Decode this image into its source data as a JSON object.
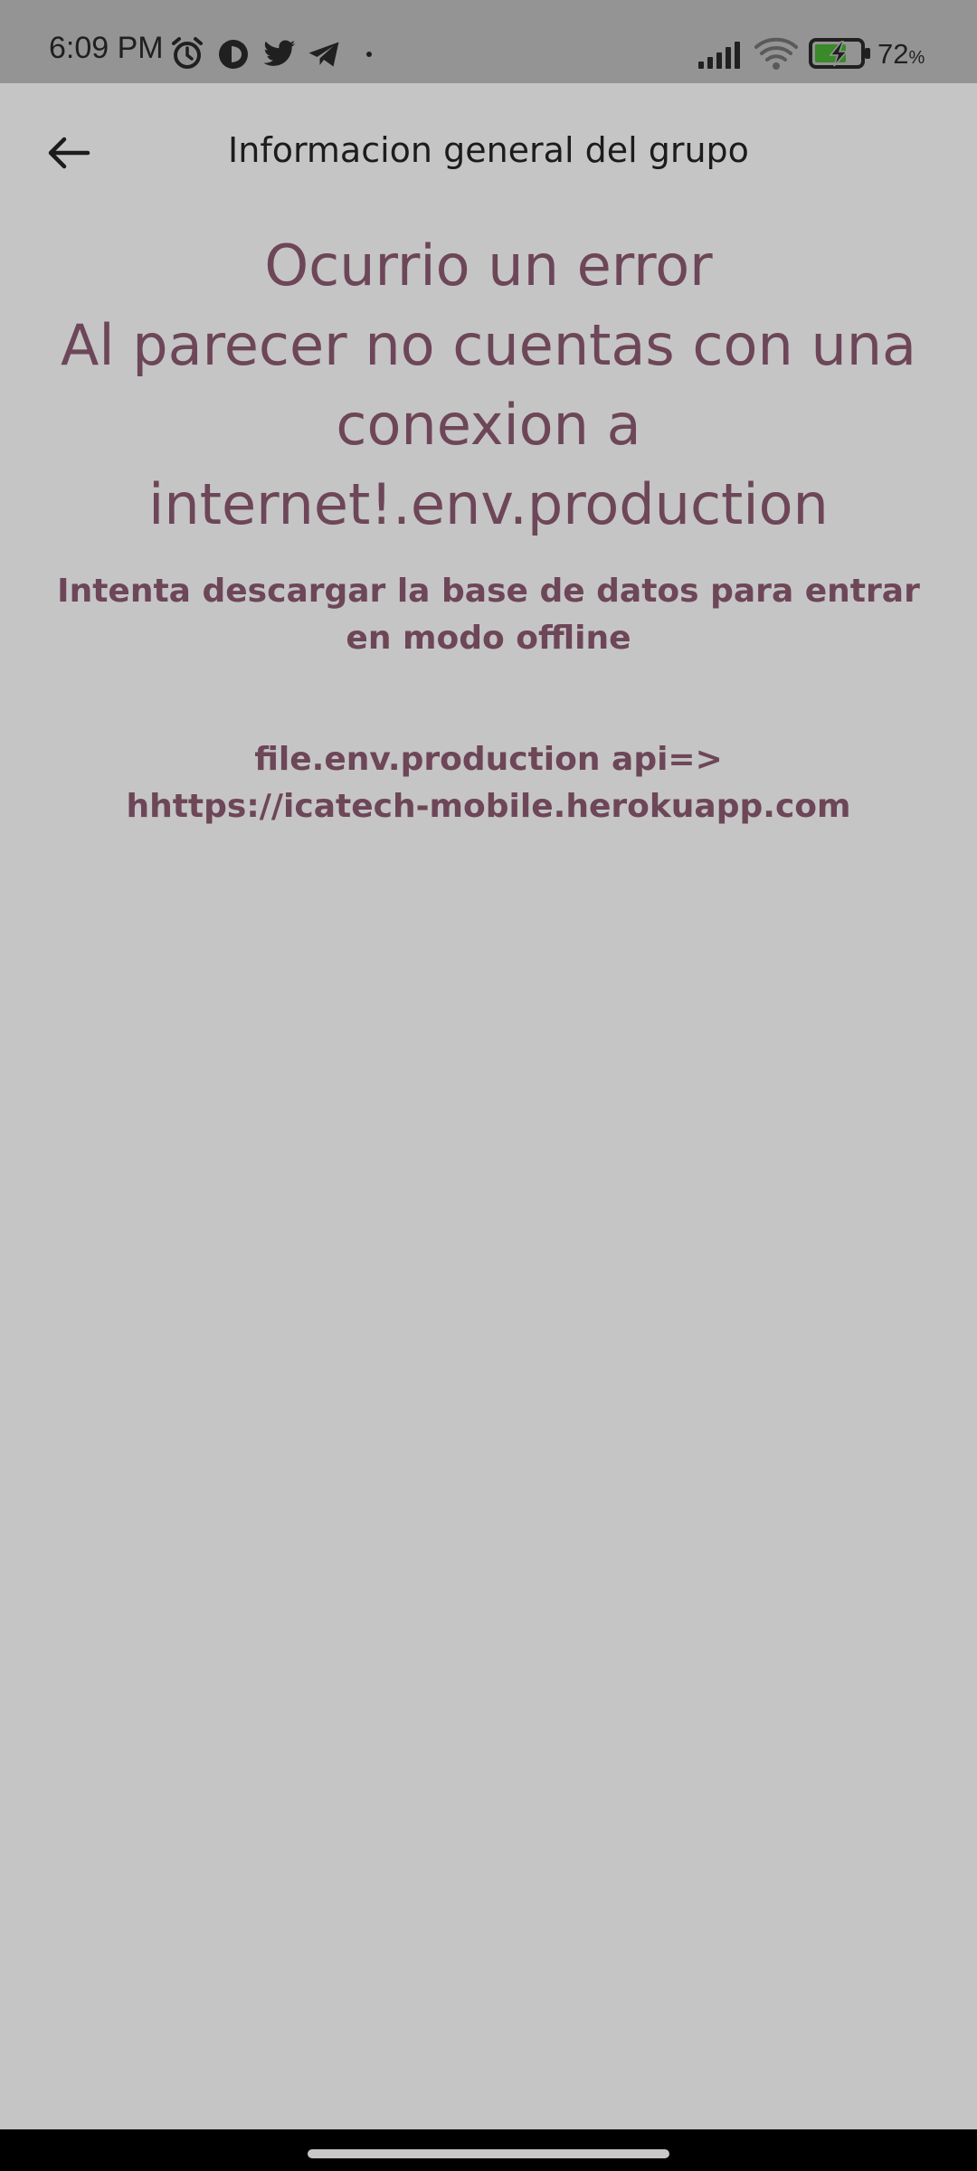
{
  "status_bar": {
    "time": "6:09 PM",
    "battery_percent": "72",
    "battery_unit": "%",
    "icons": [
      "alarm-icon",
      "app-notification-icon",
      "twitter-icon",
      "telegram-icon",
      "dot-icon",
      "signal-icon",
      "wifi-icon",
      "battery-charging-icon"
    ]
  },
  "app_bar": {
    "title": "Informacion general del grupo",
    "back_icon": "arrow-left-icon"
  },
  "error": {
    "title": "Ocurrio un error\n Al parecer no cuentas con una conexion a internet!.env.production",
    "subtitle": "Intenta descargar la base de datos para entrar en modo offline",
    "env_info": "file.env.production   api=>\nhhttps://icatech-mobile.herokuapp.com"
  },
  "colors": {
    "background": "#c5c5c5",
    "status_bar": "#949494",
    "error_text": "#6d4658",
    "title_text": "#1c1c1c"
  }
}
